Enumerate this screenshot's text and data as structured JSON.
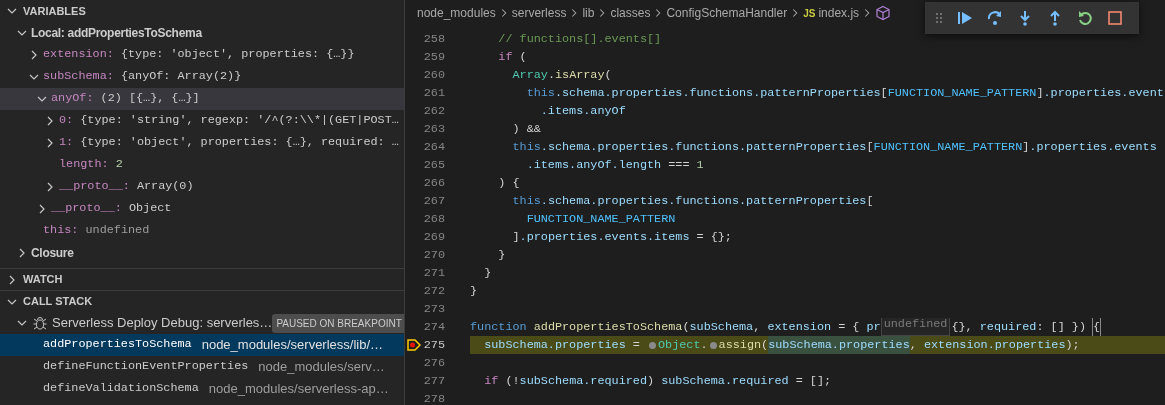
{
  "variables": {
    "title": "VARIABLES",
    "expanded": true,
    "scopes": [
      {
        "label": "Local: addPropertiesToSchema",
        "expanded": true,
        "children": [
          {
            "name": "extension:",
            "value": "{type: 'object', properties: {…}}",
            "kind": "preview",
            "expanded": false,
            "selected": false
          },
          {
            "name": "subSchema:",
            "value": "{anyOf: Array(2)}",
            "kind": "preview",
            "expanded": true,
            "selected": false,
            "children": [
              {
                "name": "anyOf:",
                "value": "(2) [{…}, {…}]",
                "kind": "preview",
                "expanded": true,
                "selected": true,
                "children": [
                  {
                    "name": "0:",
                    "value": "{type: 'string', regexp: '/^(?:\\\\*|(GET|POST…",
                    "kind": "preview",
                    "expanded": false,
                    "selected": false
                  },
                  {
                    "name": "1:",
                    "value": "{type: 'object', properties: {…}, required: …",
                    "kind": "preview",
                    "expanded": false,
                    "selected": false
                  },
                  {
                    "name": "length:",
                    "value": "2",
                    "kind": "number",
                    "selected": false
                  },
                  {
                    "name": "__proto__:",
                    "value": "Array(0)",
                    "kind": "preview",
                    "expanded": false,
                    "selected": false
                  }
                ]
              },
              {
                "name": "__proto__:",
                "value": "Object",
                "kind": "preview",
                "expanded": false,
                "selected": false
              }
            ]
          },
          {
            "name": "this:",
            "value": "undefined",
            "kind": "undefined",
            "selected": false
          }
        ]
      },
      {
        "label": "Closure",
        "expanded": false
      }
    ]
  },
  "watch": {
    "title": "WATCH",
    "expanded": false
  },
  "call_stack": {
    "title": "CALL STACK",
    "expanded": true,
    "sessions": [
      {
        "label": "Serverless Deploy Debug: serverles…",
        "badge": "PAUSED ON BREAKPOINT",
        "expanded": true,
        "frames": [
          {
            "name": "addPropertiesToSchema",
            "path": "node_modules/serverless/lib/…",
            "selected": true
          },
          {
            "name": "defineFunctionEventProperties",
            "path": "node_modules/serv…",
            "selected": false
          },
          {
            "name": "defineValidationSchema",
            "path": "node_modules/serverless-ap…",
            "selected": false
          }
        ]
      }
    ]
  },
  "breadcrumb": [
    {
      "kind": "folder",
      "label": "node_modules"
    },
    {
      "kind": "folder",
      "label": "serverless"
    },
    {
      "kind": "folder",
      "label": "lib"
    },
    {
      "kind": "folder",
      "label": "classes"
    },
    {
      "kind": "folder",
      "label": "ConfigSchemaHandler"
    },
    {
      "kind": "file",
      "badge": "JS",
      "label": "index.js"
    },
    {
      "kind": "symbol"
    }
  ],
  "editor": {
    "lines": [
      {
        "number": "258",
        "current": false,
        "breakpoint": false,
        "tokens": [
          {
            "kind": "comment",
            "text": "    // functions[].events[]"
          }
        ]
      },
      {
        "number": "259",
        "current": false,
        "breakpoint": false,
        "tokens": [
          {
            "kind": "keyword",
            "text": "    if"
          },
          {
            "kind": "plain",
            "text": " ("
          }
        ]
      },
      {
        "number": "260",
        "current": false,
        "breakpoint": false,
        "tokens": [
          {
            "kind": "class",
            "text": "      Array"
          },
          {
            "kind": "plain",
            "text": "."
          },
          {
            "kind": "function",
            "text": "isArray"
          },
          {
            "kind": "plain",
            "text": "("
          }
        ]
      },
      {
        "number": "261",
        "current": false,
        "breakpoint": false,
        "tokens": [
          {
            "kind": "storage",
            "text": "        this"
          },
          {
            "kind": "variable",
            "text": ".schema.properties.functions.patternProperties"
          },
          {
            "kind": "plain",
            "text": "["
          },
          {
            "kind": "constant",
            "text": "FUNCTION_NAME_PATTERN"
          },
          {
            "kind": "plain",
            "text": "]"
          },
          {
            "kind": "variable",
            "text": ".properties.event"
          }
        ]
      },
      {
        "number": "262",
        "current": false,
        "breakpoint": false,
        "tokens": [
          {
            "kind": "variable",
            "text": "          .items.anyOf"
          }
        ]
      },
      {
        "number": "263",
        "current": false,
        "breakpoint": false,
        "tokens": [
          {
            "kind": "plain",
            "text": "      ) &&"
          }
        ]
      },
      {
        "number": "264",
        "current": false,
        "breakpoint": false,
        "tokens": [
          {
            "kind": "storage",
            "text": "      this"
          },
          {
            "kind": "variable",
            "text": ".schema.properties.functions.patternProperties"
          },
          {
            "kind": "plain",
            "text": "["
          },
          {
            "kind": "constant",
            "text": "FUNCTION_NAME_PATTERN"
          },
          {
            "kind": "plain",
            "text": "]"
          },
          {
            "kind": "variable",
            "text": ".properties.events"
          }
        ]
      },
      {
        "number": "265",
        "current": false,
        "breakpoint": false,
        "tokens": [
          {
            "kind": "variable",
            "text": "        .items.anyOf.length"
          },
          {
            "kind": "plain",
            "text": " === "
          },
          {
            "kind": "number",
            "text": "1"
          }
        ]
      },
      {
        "number": "266",
        "current": false,
        "breakpoint": false,
        "tokens": [
          {
            "kind": "plain",
            "text": "    ) {"
          }
        ]
      },
      {
        "number": "267",
        "current": false,
        "breakpoint": false,
        "tokens": [
          {
            "kind": "storage",
            "text": "      this"
          },
          {
            "kind": "variable",
            "text": ".schema.properties.functions.patternProperties"
          },
          {
            "kind": "plain",
            "text": "["
          }
        ]
      },
      {
        "number": "268",
        "current": false,
        "breakpoint": false,
        "tokens": [
          {
            "kind": "constant",
            "text": "        FUNCTION_NAME_PATTERN"
          }
        ]
      },
      {
        "number": "269",
        "current": false,
        "breakpoint": false,
        "tokens": [
          {
            "kind": "plain",
            "text": "      ]"
          },
          {
            "kind": "variable",
            "text": ".properties.events.items"
          },
          {
            "kind": "plain",
            "text": " = {};"
          }
        ]
      },
      {
        "number": "270",
        "current": false,
        "breakpoint": false,
        "tokens": [
          {
            "kind": "plain",
            "text": "    }"
          }
        ]
      },
      {
        "number": "271",
        "current": false,
        "breakpoint": false,
        "tokens": [
          {
            "kind": "plain",
            "text": "  }"
          }
        ]
      },
      {
        "number": "272",
        "current": false,
        "breakpoint": false,
        "tokens": [
          {
            "kind": "plain",
            "text": "}"
          }
        ]
      },
      {
        "number": "273",
        "current": false,
        "breakpoint": false
      },
      {
        "number": "274",
        "current": false,
        "breakpoint": false,
        "tokens": [
          {
            "kind": "storage",
            "text": "function"
          },
          {
            "kind": "function",
            "text": " addPropertiesToSchema"
          },
          {
            "kind": "plain",
            "text": "("
          },
          {
            "kind": "variable",
            "text": "subSchema"
          },
          {
            "kind": "plain",
            "text": ", "
          },
          {
            "kind": "variable",
            "text": "extension"
          },
          {
            "kind": "plain",
            "text": " = { "
          },
          {
            "kind": "variable",
            "text": "pr"
          },
          {
            "kind": "tooltip",
            "text": "undefined"
          },
          {
            "kind": "plain",
            "text": "{}, "
          },
          {
            "kind": "variable",
            "text": "required"
          },
          {
            "kind": "plain",
            "text": ": [] }) "
          },
          {
            "kind": "bracket",
            "text": "{"
          }
        ]
      },
      {
        "number": "275",
        "current": true,
        "breakpoint": true,
        "tokens": [
          {
            "kind": "variable",
            "text": "  subSchema.properties"
          },
          {
            "kind": "plain",
            "text": " = "
          },
          {
            "kind": "dot"
          },
          {
            "kind": "class",
            "text": "Object"
          },
          {
            "kind": "plain",
            "text": "."
          },
          {
            "kind": "dot"
          },
          {
            "kind": "function",
            "text": "assign"
          },
          {
            "kind": "plain",
            "text": "("
          },
          {
            "kind": "match",
            "text": "subSchema.properties"
          },
          {
            "kind": "plain",
            "text": ", "
          },
          {
            "kind": "variable",
            "text": "extension.properties"
          },
          {
            "kind": "plain",
            "text": ");"
          }
        ]
      },
      {
        "number": "276",
        "current": false,
        "breakpoint": false
      },
      {
        "number": "277",
        "current": false,
        "breakpoint": false,
        "tokens": [
          {
            "kind": "keyword",
            "text": "  if"
          },
          {
            "kind": "plain",
            "text": " (!"
          },
          {
            "kind": "variable",
            "text": "subSchema.required"
          },
          {
            "kind": "plain",
            "text": ") "
          },
          {
            "kind": "variable",
            "text": "subSchema.required"
          },
          {
            "kind": "plain",
            "text": " = [];"
          }
        ]
      },
      {
        "number": "278",
        "current": false,
        "breakpoint": false
      }
    ]
  }
}
